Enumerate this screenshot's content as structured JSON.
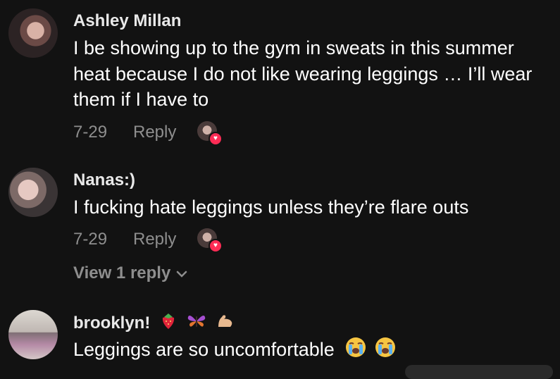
{
  "comments": [
    {
      "username": "Ashley Millan",
      "text": "I be showing up to the gym in sweats in this summer heat because I do not like wearing leggings … I’ll wear them if I have to",
      "date": "7-29",
      "reply_label": "Reply"
    },
    {
      "username": "Nanas:)",
      "text": "I fucking hate leggings unless they’re flare outs",
      "date": "7-29",
      "reply_label": "Reply",
      "view_replies_label": "View 1 reply"
    },
    {
      "username": "brooklyn!",
      "username_emojis": [
        "strawberry",
        "butterfly",
        "flexed-biceps"
      ],
      "text": "Leggings are so uncomfortable",
      "text_emojis": [
        "loudly-crying-face",
        "loudly-crying-face"
      ]
    }
  ],
  "colors": {
    "background": "#121212",
    "primary_text": "#ffffff",
    "secondary_text": "#8e8e8e",
    "like_badge": "#fe2c55"
  }
}
